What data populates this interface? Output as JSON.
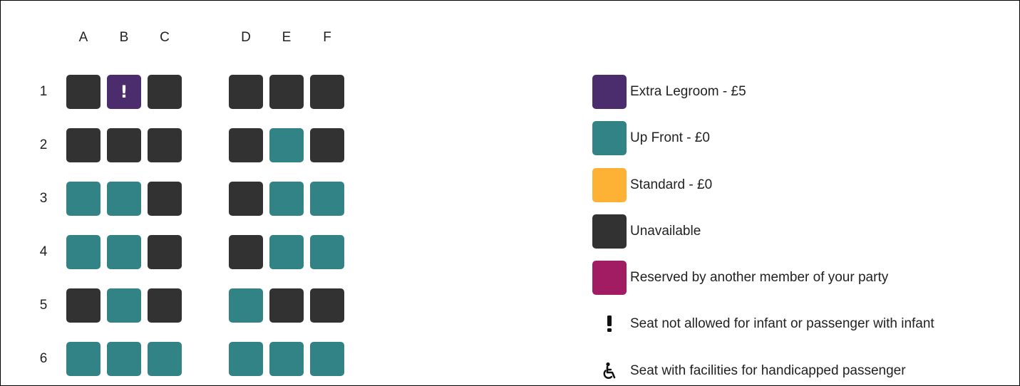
{
  "colors": {
    "extra_legroom": "#4b2d6e",
    "up_front": "#318385",
    "standard": "#fdb135",
    "unavailable": "#323232",
    "reserved_party": "#a21c63"
  },
  "seat_map": {
    "columns": [
      "A",
      "B",
      "C",
      "D",
      "E",
      "F"
    ],
    "rows": [
      {
        "label": "1",
        "seats": [
          {
            "type": "unavailable"
          },
          {
            "type": "extra_legroom",
            "icon": "infant-restriction-icon",
            "glyph": "!"
          },
          {
            "type": "unavailable"
          },
          {
            "type": "unavailable"
          },
          {
            "type": "unavailable"
          },
          {
            "type": "unavailable"
          }
        ]
      },
      {
        "label": "2",
        "seats": [
          {
            "type": "unavailable"
          },
          {
            "type": "unavailable"
          },
          {
            "type": "unavailable"
          },
          {
            "type": "unavailable"
          },
          {
            "type": "up_front"
          },
          {
            "type": "unavailable"
          }
        ]
      },
      {
        "label": "3",
        "seats": [
          {
            "type": "up_front"
          },
          {
            "type": "up_front"
          },
          {
            "type": "unavailable"
          },
          {
            "type": "unavailable"
          },
          {
            "type": "up_front"
          },
          {
            "type": "up_front"
          }
        ]
      },
      {
        "label": "4",
        "seats": [
          {
            "type": "up_front"
          },
          {
            "type": "up_front"
          },
          {
            "type": "unavailable"
          },
          {
            "type": "unavailable"
          },
          {
            "type": "up_front"
          },
          {
            "type": "up_front"
          }
        ]
      },
      {
        "label": "5",
        "seats": [
          {
            "type": "unavailable"
          },
          {
            "type": "up_front"
          },
          {
            "type": "unavailable"
          },
          {
            "type": "up_front"
          },
          {
            "type": "unavailable"
          },
          {
            "type": "unavailable"
          }
        ]
      },
      {
        "label": "6",
        "seats": [
          {
            "type": "up_front"
          },
          {
            "type": "up_front"
          },
          {
            "type": "up_front"
          },
          {
            "type": "up_front"
          },
          {
            "type": "up_front"
          },
          {
            "type": "up_front"
          }
        ]
      }
    ]
  },
  "legend": {
    "items": [
      {
        "swatch": "extra_legroom",
        "label": "Extra Legroom - £5"
      },
      {
        "swatch": "up_front",
        "label": "Up Front - £0"
      },
      {
        "swatch": "standard",
        "label": "Standard - £0"
      },
      {
        "swatch": "unavailable",
        "label": "Unavailable"
      },
      {
        "swatch": "reserved_party",
        "label": "Reserved by another member of your party"
      },
      {
        "icon": "exclamation-icon",
        "label": "Seat not allowed for infant or passenger with infant"
      },
      {
        "icon": "wheelchair-icon",
        "label": "Seat with facilities for handicapped passenger"
      }
    ]
  }
}
